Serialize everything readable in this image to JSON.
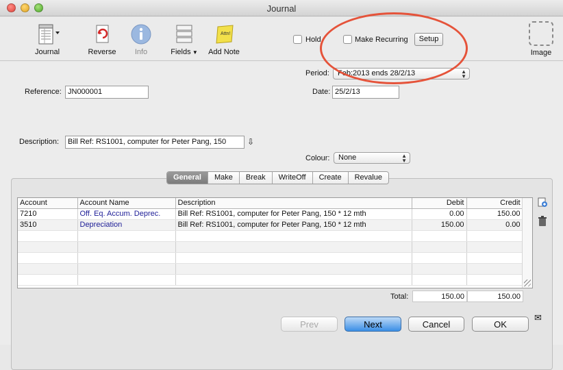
{
  "window": {
    "title": "Journal"
  },
  "toolbar": {
    "journal_label": "Journal",
    "reverse_label": "Reverse",
    "info_label": "Info",
    "fields_label": "Fields",
    "add_note_label": "Add Note",
    "add_note_icon_text": "Attn!",
    "hold_label": "Hold",
    "make_recurring_label": "Make Recurring",
    "setup_label": "Setup",
    "image_label": "Image"
  },
  "form": {
    "period_label": "Period:",
    "period_value": "Feb:2013 ends 28/2/13",
    "reference_label": "Reference:",
    "reference_value": "JN000001",
    "date_label": "Date:",
    "date_value": "25/2/13",
    "description_label": "Description:",
    "description_value": "Bill Ref: RS1001, computer for Peter Pang, 150",
    "colour_label": "Colour:",
    "colour_value": "None"
  },
  "tabs": [
    "General",
    "Make",
    "Break",
    "WriteOff",
    "Create",
    "Revalue"
  ],
  "active_tab": "General",
  "grid": {
    "columns": [
      "Account",
      "Account Name",
      "Description",
      "Debit",
      "Credit"
    ],
    "rows": [
      {
        "account": "7210",
        "name": "Off. Eq. Accum. Deprec.",
        "description": "Bill Ref: RS1001, computer for Peter Pang, 150 * 12 mth",
        "debit": "0.00",
        "credit": "150.00"
      },
      {
        "account": "3510",
        "name": "Depreciation",
        "description": "Bill Ref: RS1001, computer for Peter Pang, 150 * 12 mth",
        "debit": "150.00",
        "credit": "0.00"
      }
    ],
    "empty_rows": 5,
    "totals_label": "Total:",
    "total_debit": "150.00",
    "total_credit": "150.00"
  },
  "buttons": {
    "prev": "Prev",
    "next": "Next",
    "cancel": "Cancel",
    "ok": "OK"
  },
  "colors": {
    "highlight_ellipse": "#e5533a",
    "default_button": "#3a8ee6",
    "account_name_link": "#1c1c96"
  }
}
